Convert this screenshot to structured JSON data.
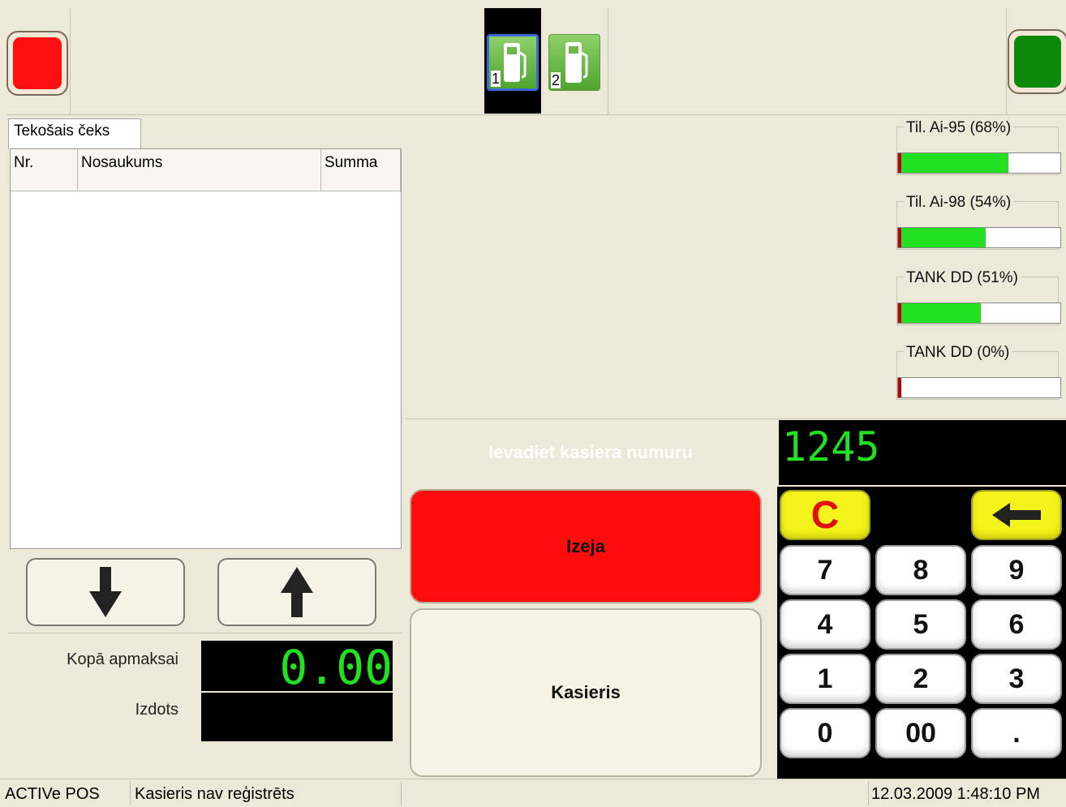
{
  "pumps": [
    {
      "number": "1",
      "selected": true
    },
    {
      "number": "2",
      "selected": false
    }
  ],
  "receipt": {
    "tab_label": "Tekošais čeks",
    "columns": [
      "Nr.",
      "Nosaukums",
      "Summa"
    ],
    "rows": []
  },
  "totals": {
    "total_label": "Kopā apmaksai",
    "total_value": "0.00",
    "change_label": "Izdots",
    "change_value": ""
  },
  "tanks": [
    {
      "label": "Til. Ai-95 (68%)",
      "level": 0.68
    },
    {
      "label": "Til.  Ai-98 (54%)",
      "level": 0.54
    },
    {
      "label": "TANK DD (51%)",
      "level": 0.51
    },
    {
      "label": "TANK DD (0%)",
      "level": 0.0
    }
  ],
  "prompt": "Ievadiet kasiera numuru",
  "display_value": "1245",
  "buttons": {
    "exit_label": "Izeja",
    "cashier_label": "Kasieris"
  },
  "keypad": {
    "clear": "C",
    "keys": [
      "7",
      "8",
      "9",
      "4",
      "5",
      "6",
      "1",
      "2",
      "3",
      "0",
      "00",
      "."
    ]
  },
  "status": {
    "app": "ACTIVe POS",
    "cashier": "Kasieris nav reģistrēts",
    "datetime": "12.03.2009 1:48:10 PM"
  },
  "colors": {
    "stop": "#ff0000",
    "go": "#008a00",
    "lcd_text": "#22e022",
    "tank_fill": "#23e023"
  },
  "icons": [
    "fuel-pump-icon",
    "arrow-down-icon",
    "arrow-up-icon",
    "backspace-arrow-icon"
  ]
}
